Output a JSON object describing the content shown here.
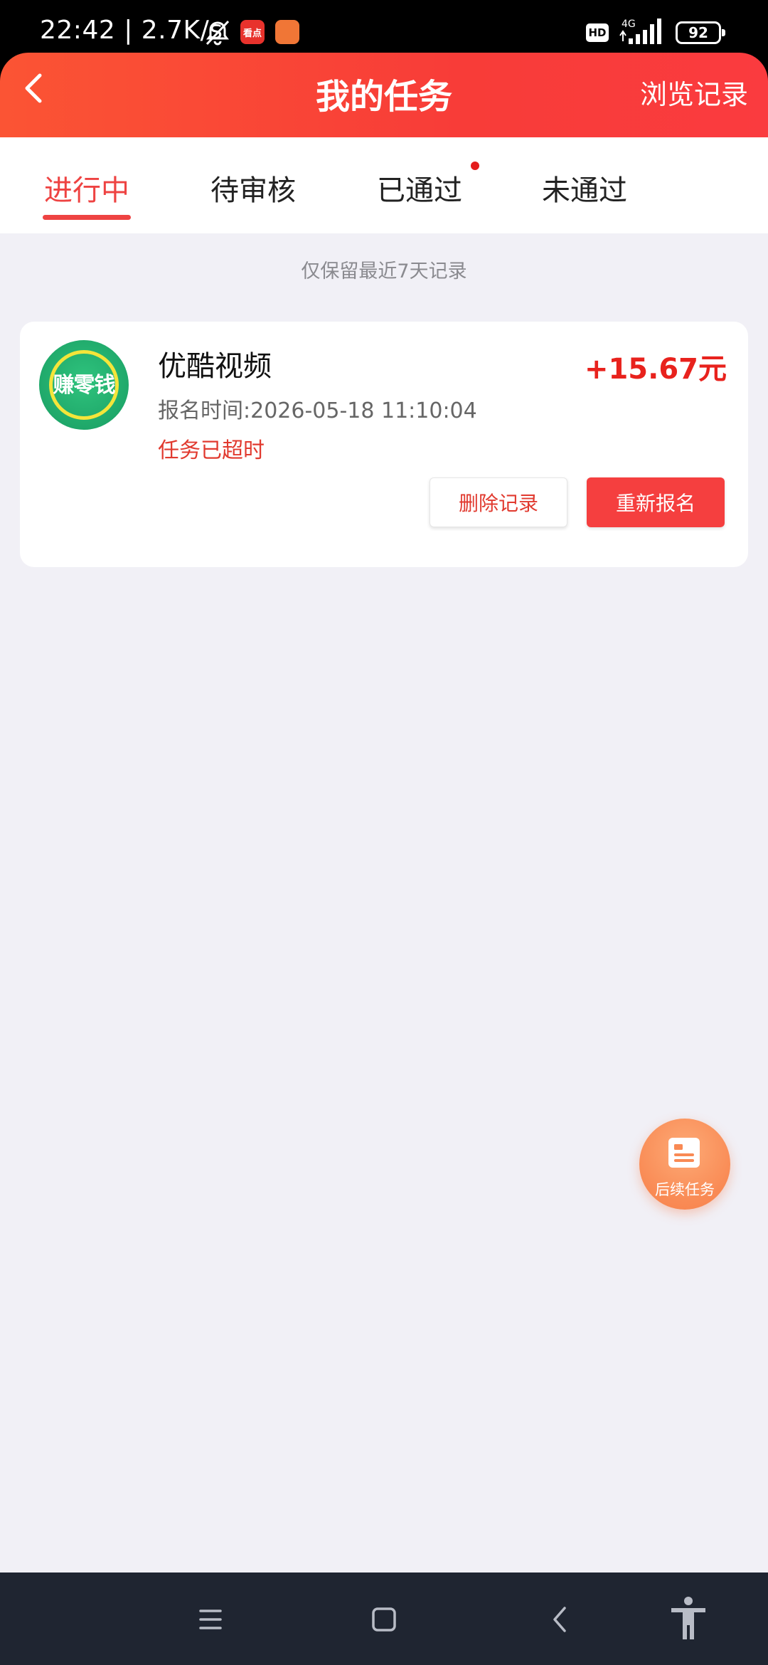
{
  "status_bar": {
    "time": "22:42 | 2.7K/s",
    "app1_label": "看点",
    "hd_label": "HD",
    "network_label": "4G",
    "battery_level": "92"
  },
  "header": {
    "title": "我的任务",
    "history_label": "浏览记录"
  },
  "tabs": [
    {
      "label": "进行中",
      "active": true
    },
    {
      "label": "待审核",
      "active": false
    },
    {
      "label": "已通过",
      "active": false,
      "has_dot": true
    },
    {
      "label": "未通过",
      "active": false
    }
  ],
  "notice": "仅保留最近7天记录",
  "task": {
    "logo_text": "赚零钱",
    "name": "优酷视频",
    "reward": "+15.67元",
    "signup_time": "报名时间:2026-05-18 11:10:04",
    "status": "任务已超时",
    "delete_label": "删除记录",
    "resign_label": "重新报名"
  },
  "fab": {
    "label": "后续任务"
  },
  "colors": {
    "accent": "#ee4342",
    "header_gradient_start": "#fb5434",
    "header_gradient_end": "#fa3b3f",
    "button_red": "#f53f3f",
    "fab_orange": "#f98a54",
    "logo_green": "#1fa86a",
    "background": "#f1f0f6",
    "nav_bar": "#1f2531"
  },
  "icons": {
    "back": "chevron-left-icon",
    "bell_muted": "bell-off-icon",
    "fab": "task-list-icon",
    "nav_menu": "menu-icon",
    "nav_home": "home-square-icon",
    "nav_back": "back-chevron-icon",
    "nav_accessibility": "accessibility-icon"
  }
}
